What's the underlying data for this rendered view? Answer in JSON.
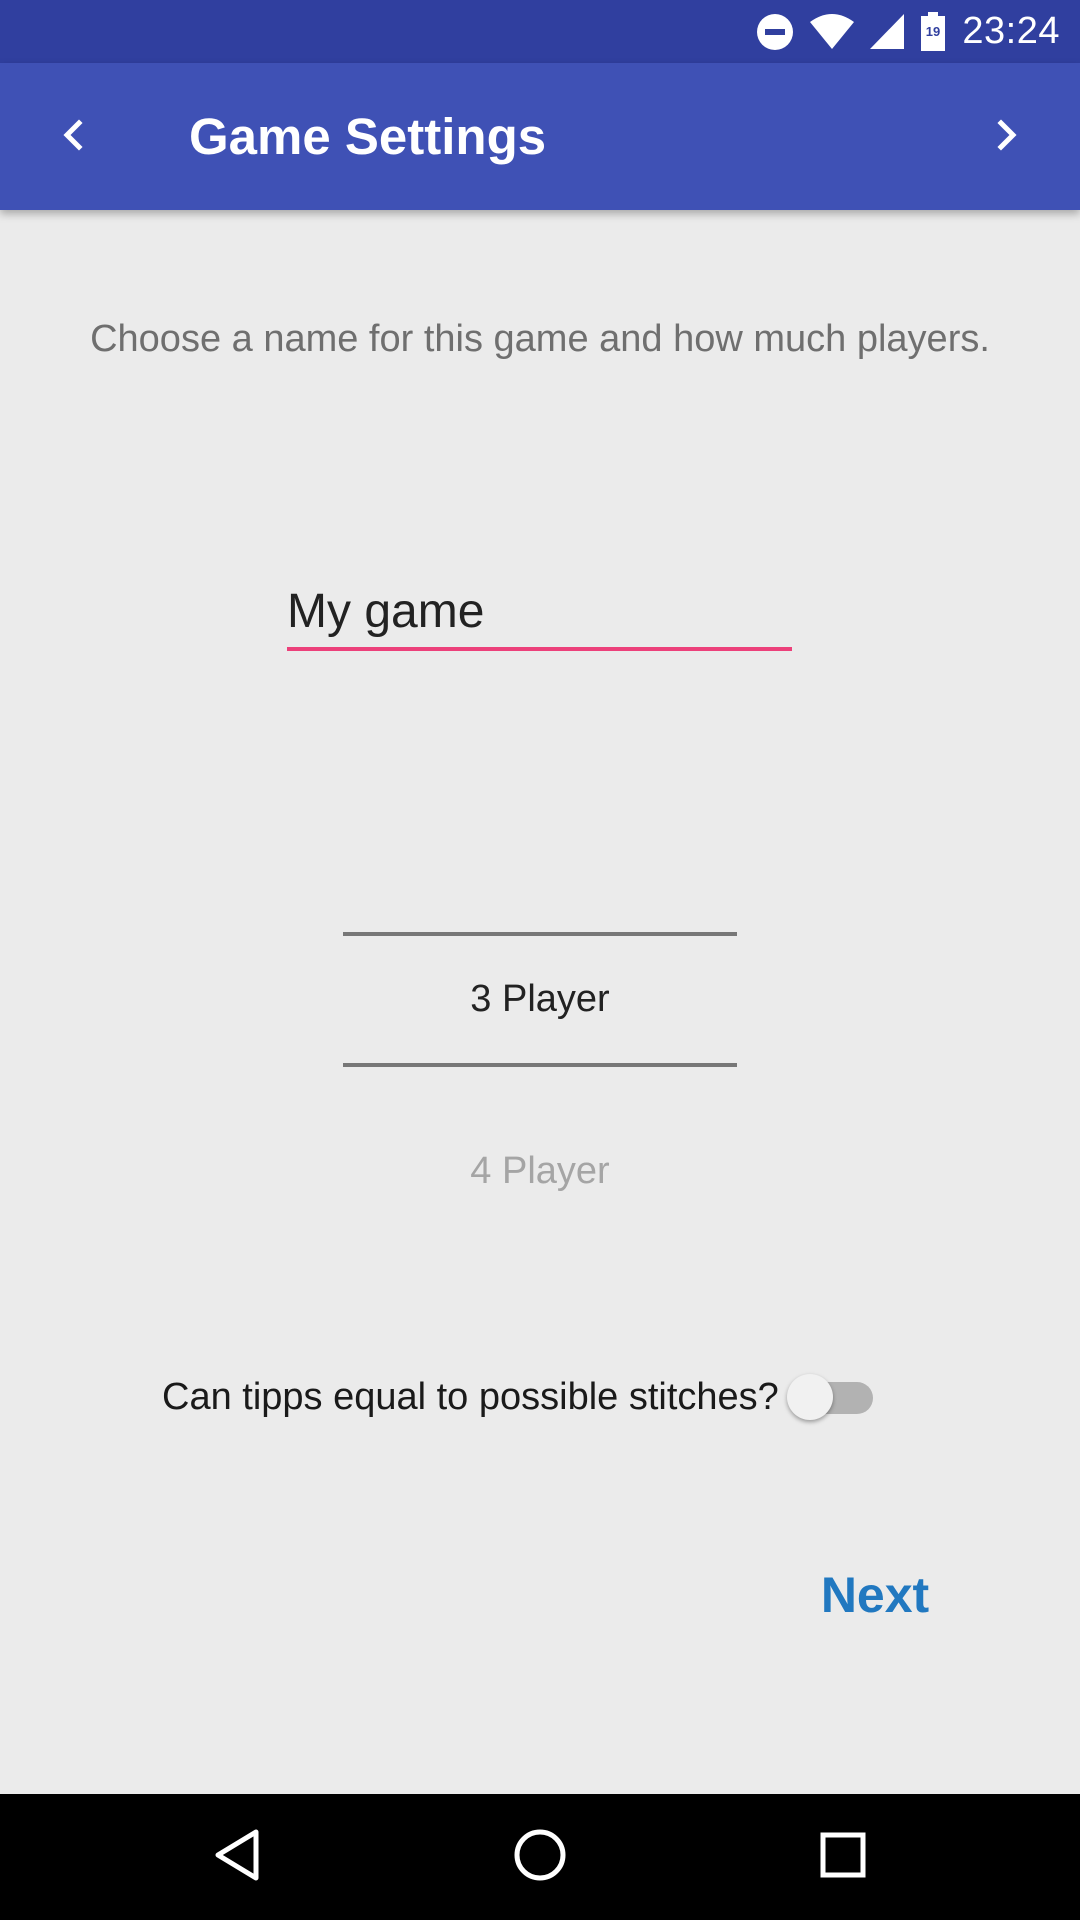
{
  "status_bar": {
    "time": "23:24",
    "battery_level": "19",
    "icons": [
      "do-not-disturb-icon",
      "wifi-icon",
      "signal-icon",
      "battery-icon"
    ]
  },
  "app_bar": {
    "title": "Game Settings",
    "back_icon": "chevron-left-icon",
    "forward_icon": "chevron-right-icon"
  },
  "content": {
    "instructions": "Choose a name for this game and how much players.",
    "game_name": {
      "value": "My game",
      "placeholder": ""
    },
    "player_picker": {
      "selected": "3 Player",
      "next_option": "4 Player"
    },
    "equal_tipps_switch": {
      "label": "Can tipps equal to possible stitches?",
      "checked": false
    },
    "next_button": "Next"
  },
  "navigation_bar": {
    "buttons": [
      "back-triangle-icon",
      "home-circle-icon",
      "recents-square-icon"
    ]
  },
  "colors": {
    "status_bar": "#303f9f",
    "app_bar": "#3f51b5",
    "accent": "#ec407a",
    "next_button": "#2178c0",
    "background": "#ebebeb"
  }
}
